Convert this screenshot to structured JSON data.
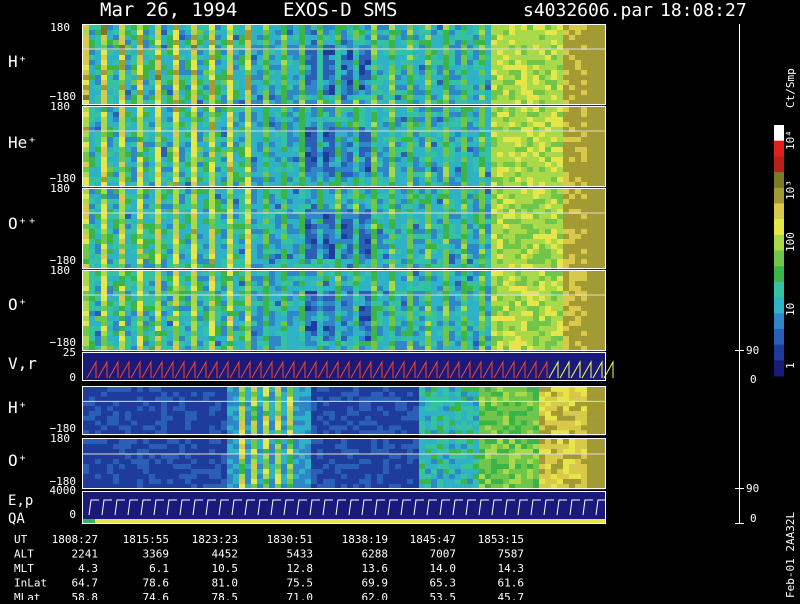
{
  "header": {
    "date": "Mar 26, 1994",
    "instrument": "EXOS-D SMS",
    "file": "s4032606.par",
    "time": "18:08:27"
  },
  "colorbar": {
    "unit": "Ct/Smp",
    "tick_labels": [
      "10⁴",
      "10³",
      "100",
      "10",
      "1"
    ],
    "colors": [
      "#1a1a7a",
      "#1e3c9c",
      "#2a5fb5",
      "#2f87c8",
      "#2fb2c6",
      "#35c2a3",
      "#3bb44a",
      "#6fc64a",
      "#a8d94b",
      "#e6e64a",
      "#d8c94a",
      "#a39a33",
      "#7a7a29",
      "#b8201a",
      "#e0201a",
      "#ffffff"
    ]
  },
  "panels": {
    "h_plus": {
      "label": "H⁺",
      "ymax": "180",
      "ymin": "−180"
    },
    "he_plus": {
      "label": "He⁺",
      "ymax": "180",
      "ymin": "−180"
    },
    "o_pp": {
      "label": "O⁺⁺",
      "ymax": "180",
      "ymin": "−180"
    },
    "o_plus": {
      "label": "O⁺",
      "ymax": "180",
      "ymin": "−180"
    },
    "vr": {
      "label": "V,r",
      "ymax": "25",
      "ymin": "0",
      "right_max": "90",
      "right_min": "0"
    },
    "h_plus2": {
      "label": "H⁺",
      "ymin": "−180"
    },
    "o_plus2": {
      "label": "O⁺",
      "ymax": "180",
      "ymin": "−180"
    },
    "ep": {
      "label": "E,p",
      "ymax": "4000",
      "ymin": "0",
      "right_max": "90",
      "right_min": "0"
    },
    "qa": {
      "label": "QA"
    }
  },
  "table": {
    "rows": [
      {
        "label": "UT",
        "values": [
          "1808:27",
          "1815:55",
          "1823:23",
          "1830:51",
          "1838:19",
          "1845:47",
          "1853:15"
        ]
      },
      {
        "label": "ALT",
        "values": [
          "2241",
          "3369",
          "4452",
          "5433",
          "6288",
          "7007",
          "7587"
        ]
      },
      {
        "label": "MLT",
        "values": [
          "4.3",
          "6.1",
          "10.5",
          "12.8",
          "13.6",
          "14.0",
          "14.3"
        ]
      },
      {
        "label": "InLat",
        "values": [
          "64.7",
          "78.6",
          "81.0",
          "75.5",
          "69.9",
          "65.3",
          "61.6"
        ]
      },
      {
        "label": "MLat",
        "values": [
          "58.8",
          "74.6",
          "78.5",
          "71.0",
          "62.0",
          "53.5",
          "45.7"
        ]
      }
    ]
  },
  "footer": {
    "vertical_text": "Feb-01 2AA32L"
  },
  "chart_data": {
    "type": "heatmap",
    "title": "Mar 26, 1994   EXOS-D SMS",
    "x_ticks": [
      "1808:27",
      "1815:55",
      "1823:23",
      "1830:51",
      "1838:19",
      "1845:47",
      "1853:15"
    ],
    "spectrogram_ylim": [
      -180,
      180
    ],
    "vr_ylim": [
      0,
      25
    ],
    "vr_right_ylim": [
      0,
      90
    ],
    "ep_ylim": [
      0,
      4000
    ],
    "ep_right_ylim": [
      0,
      90
    ],
    "colorbar_range": [
      1,
      10000
    ],
    "colorbar_scale": "log"
  }
}
